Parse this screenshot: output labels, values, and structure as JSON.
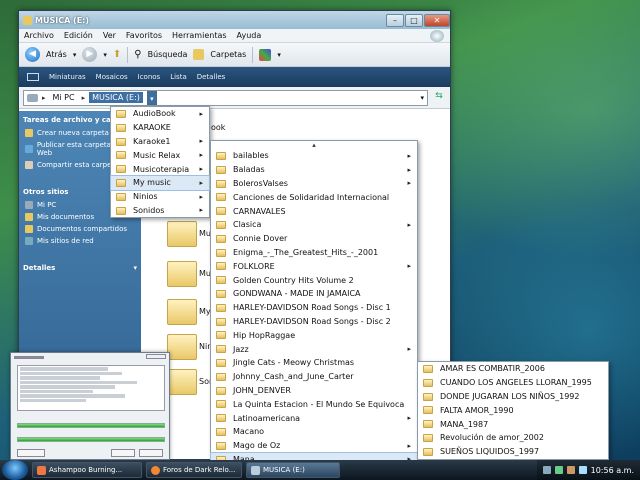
{
  "window": {
    "title": "MUSICA (E:)",
    "menu": [
      "Archivo",
      "Edición",
      "Ver",
      "Favoritos",
      "Herramientas",
      "Ayuda"
    ],
    "toolbar": {
      "back": "Atrás",
      "search": "Búsqueda",
      "folders": "Carpetas"
    },
    "views": [
      "Miniaturas",
      "Mosaicos",
      "Iconos",
      "Lista",
      "Detalles"
    ],
    "address": {
      "crumb1": "Mi PC",
      "crumb2": "MUSICA (E:)"
    }
  },
  "taskpane": {
    "section1": "Tareas de archivo y carpeta",
    "tasks": [
      "Crear nueva carpeta",
      "Publicar esta carpeta en Web",
      "Compartir esta carpeta"
    ],
    "section2": "Otros sitios",
    "places": [
      "Mi PC",
      "Mis documentos",
      "Documentos compartidos",
      "Mis sitios de red"
    ],
    "section3": "Detalles"
  },
  "content": {
    "partial_folder": "ook",
    "folders": [
      "Music Re",
      "Musicote",
      "My music",
      "Ninios",
      "Sonidos"
    ]
  },
  "menu1": {
    "items": [
      {
        "label": "AudioBook",
        "sub": true
      },
      {
        "label": "KARAOKE",
        "sub": false
      },
      {
        "label": "Karaoke1",
        "sub": true
      },
      {
        "label": "Music Relax",
        "sub": true
      },
      {
        "label": "Musicoterapia",
        "sub": true
      },
      {
        "label": "My music",
        "sub": true
      },
      {
        "label": "Ninios",
        "sub": true
      },
      {
        "label": "Sonidos",
        "sub": true
      }
    ],
    "selected": 5
  },
  "menu2": {
    "items": [
      {
        "label": "bailables",
        "sub": true
      },
      {
        "label": "Baladas",
        "sub": true
      },
      {
        "label": "BolerosValses",
        "sub": true
      },
      {
        "label": "Canciones de Solidaridad Internacional",
        "sub": false
      },
      {
        "label": "CARNAVALES",
        "sub": false
      },
      {
        "label": "Clasica",
        "sub": true
      },
      {
        "label": "Connie Dover",
        "sub": false
      },
      {
        "label": "Enigma_-_The_Greatest_Hits_-_2001",
        "sub": false
      },
      {
        "label": "FOLKLORE",
        "sub": true
      },
      {
        "label": "Golden Country Hits Volume 2",
        "sub": false
      },
      {
        "label": "GONDWANA - MADE IN JAMAICA",
        "sub": false
      },
      {
        "label": "HARLEY-DAVIDSON Road Songs - Disc 1",
        "sub": false
      },
      {
        "label": "HARLEY-DAVIDSON Road Songs - Disc 2",
        "sub": false
      },
      {
        "label": "Hip HopRaggae",
        "sub": false
      },
      {
        "label": "Jazz",
        "sub": true
      },
      {
        "label": "Jingle Cats - Meowy Christmas",
        "sub": false
      },
      {
        "label": "Johnny_Cash_and_June_Carter",
        "sub": false
      },
      {
        "label": "JOHN_DENVER",
        "sub": false
      },
      {
        "label": "La Quinta Estacion - El Mundo Se Equivoca",
        "sub": false
      },
      {
        "label": "Latinoamericana",
        "sub": true
      },
      {
        "label": "Macano",
        "sub": false
      },
      {
        "label": "Mago de Oz",
        "sub": true
      },
      {
        "label": "Mana",
        "sub": true
      }
    ],
    "selected": 22
  },
  "menu3": {
    "items": [
      "AMAR ES COMBATIR_2006",
      "CUANDO LOS ANGELES LLORAN_1995",
      "DONDE JUGARAN LOS NIÑOS_1992",
      "FALTA AMOR_1990",
      "MANA_1987",
      "Revolución de amor_2002",
      "SUEÑOS LIQUIDOS_1997"
    ]
  },
  "taskbar": {
    "buttons": [
      "Ashampoo Burning...",
      "Foros de Dark Relo...",
      "MUSICA (E:)"
    ],
    "clock": "10:56 a.m."
  },
  "colors": {
    "accent": "#3d6fa3",
    "taskpane": "#3b70a0",
    "taskbar": "#1a2a38"
  }
}
